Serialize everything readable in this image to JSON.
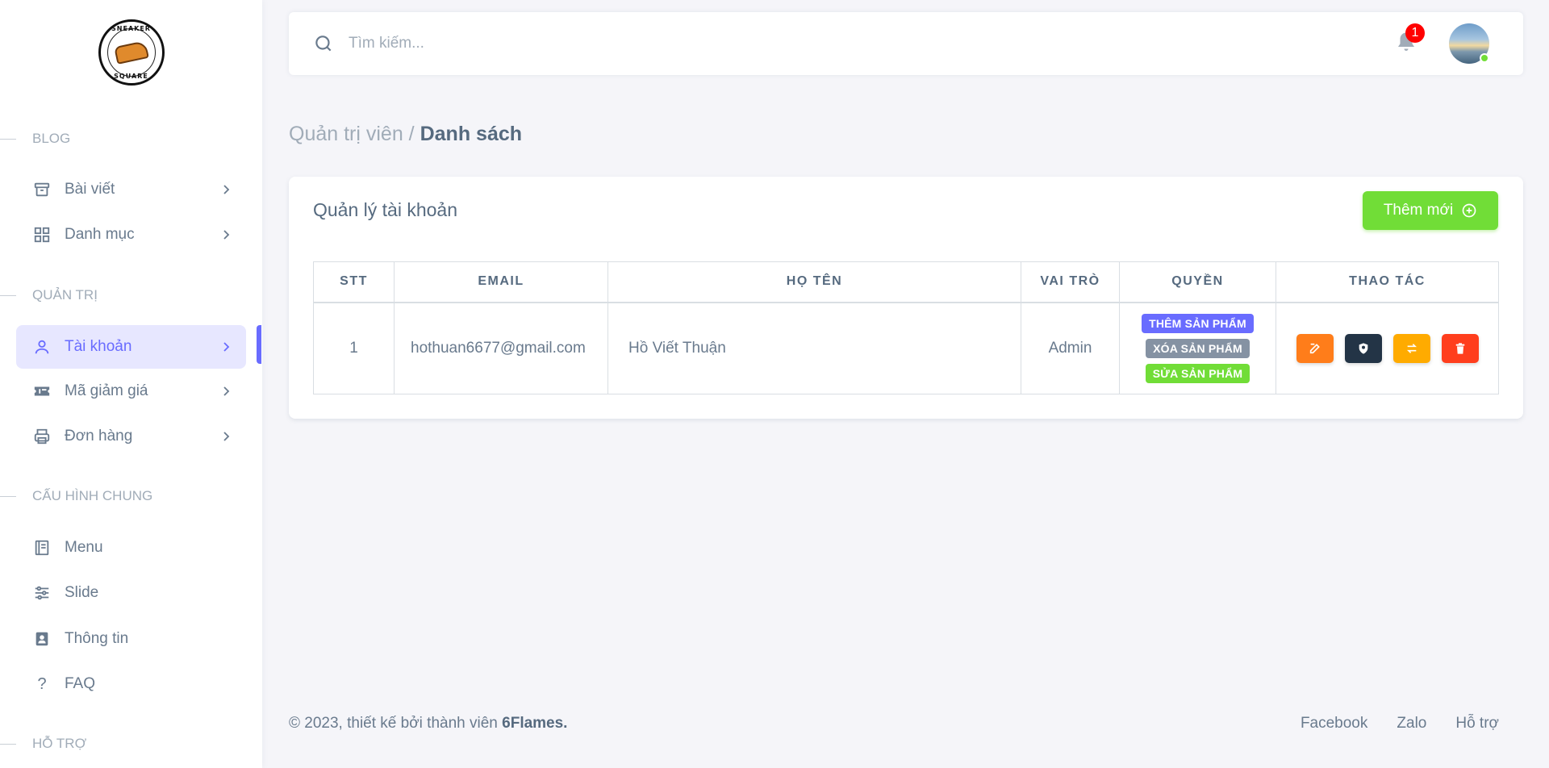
{
  "logo": {
    "top_text": "SNEAKER",
    "bottom_text": "SQUARE"
  },
  "sidebar": {
    "sections": [
      {
        "header": "BLOG"
      },
      {
        "header": "QUẢN TRỊ"
      },
      {
        "header": "CẤU HÌNH CHUNG"
      },
      {
        "header": "HỖ TRỢ"
      }
    ],
    "items": [
      {
        "label": "Bài viết",
        "icon": "archive-icon"
      },
      {
        "label": "Danh mục",
        "icon": "grid-icon"
      },
      {
        "label": "Tài khoản",
        "icon": "user-icon",
        "active": true
      },
      {
        "label": "Mã giảm giá",
        "icon": "ticket-icon"
      },
      {
        "label": "Đơn hàng",
        "icon": "printer-icon"
      },
      {
        "label": "Menu",
        "icon": "book-icon"
      },
      {
        "label": "Slide",
        "icon": "sliders-icon"
      },
      {
        "label": "Thông tin",
        "icon": "contact-icon"
      },
      {
        "label": "FAQ",
        "icon": "question-icon"
      }
    ]
  },
  "navbar": {
    "search_placeholder": "Tìm kiếm...",
    "notification_count": "1"
  },
  "breadcrumb": {
    "parent": "Quản trị viên /",
    "current": "Danh sách"
  },
  "card": {
    "title": "Quản lý tài khoản",
    "add_button": "Thêm mới"
  },
  "table": {
    "headers": [
      "STT",
      "EMAIL",
      "HỌ TÊN",
      "VAI TRÒ",
      "QUYỀN",
      "THAO TÁC"
    ],
    "rows": [
      {
        "stt": "1",
        "email": "hothuan6677@gmail.com",
        "name": "Hồ Viết Thuận",
        "role": "Admin",
        "permissions": [
          {
            "label": "THÊM SẢN PHẨM",
            "color": "#696cff"
          },
          {
            "label": "XÓA SẢN PHẨM",
            "color": "#8592a3"
          },
          {
            "label": "SỬA SẢN PHẨM",
            "color": "#71dd37"
          }
        ]
      }
    ]
  },
  "colors": {
    "primary": "#696cff",
    "success": "#71dd37",
    "edit": "#ff7d1a",
    "view": "#233446",
    "switch": "#ffab00",
    "delete": "#ff3e1d"
  },
  "footer": {
    "copyright": "© 2023, thiết kế bởi thành viên",
    "brand": "6Flames.",
    "links": [
      "Facebook",
      "Zalo",
      "Hỗ trợ"
    ]
  }
}
